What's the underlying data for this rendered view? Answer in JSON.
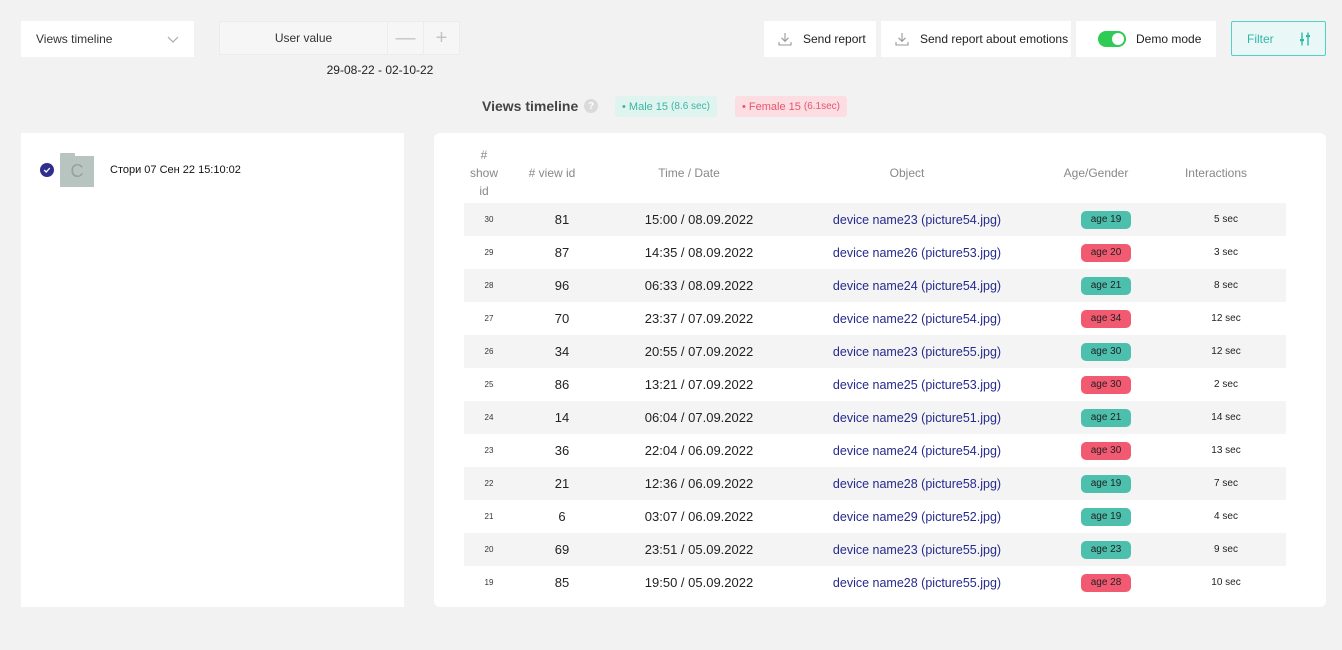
{
  "toolbar": {
    "view_select": "Views timeline",
    "stepper_value": "User value",
    "stepper_minus": "—",
    "stepper_plus": "+",
    "date_range": "29-08-22 - 02-10-22",
    "send_report": "Send report",
    "send_report_emotions": "Send report about emotions",
    "demo_mode": "Demo mode",
    "demo_mode_on": true,
    "filter": "Filter"
  },
  "summary": {
    "title": "Views timeline",
    "help": "?",
    "male_label": "• Male 15",
    "male_sec": "(8.6 sec)",
    "female_label": "• Female 15",
    "female_sec": "(6.1sec)"
  },
  "colors": {
    "male": "#4cbfad",
    "female": "#f25a72",
    "accent": "#2fb8a9",
    "link": "#262a8c"
  },
  "story": {
    "folder_letter": "C",
    "label": "Стори 07 Сен 22 15:10:02"
  },
  "table": {
    "headers": [
      "# show id",
      "# view id",
      "Time / Date",
      "Object",
      "Age/Gender",
      "Interactions"
    ],
    "rows": [
      {
        "show_id": "30",
        "view_id": "81",
        "time": "15:00 / 08.09.2022",
        "object": "device name23 (picture54.jpg)",
        "age": "age 19",
        "gender": "m",
        "interactions": "5 sec"
      },
      {
        "show_id": "29",
        "view_id": "87",
        "time": "14:35 / 08.09.2022",
        "object": "device name26 (picture53.jpg)",
        "age": "age 20",
        "gender": "f",
        "interactions": "3 sec"
      },
      {
        "show_id": "28",
        "view_id": "96",
        "time": "06:33 / 08.09.2022",
        "object": "device name24 (picture54.jpg)",
        "age": "age 21",
        "gender": "m",
        "interactions": "8 sec"
      },
      {
        "show_id": "27",
        "view_id": "70",
        "time": "23:37 / 07.09.2022",
        "object": "device name22 (picture54.jpg)",
        "age": "age 34",
        "gender": "f",
        "interactions": "12 sec"
      },
      {
        "show_id": "26",
        "view_id": "34",
        "time": "20:55 / 07.09.2022",
        "object": "device name23 (picture55.jpg)",
        "age": "age 30",
        "gender": "m",
        "interactions": "12 sec"
      },
      {
        "show_id": "25",
        "view_id": "86",
        "time": "13:21 / 07.09.2022",
        "object": "device name25 (picture53.jpg)",
        "age": "age 30",
        "gender": "f",
        "interactions": "2 sec"
      },
      {
        "show_id": "24",
        "view_id": "14",
        "time": "06:04 / 07.09.2022",
        "object": "device name29 (picture51.jpg)",
        "age": "age 21",
        "gender": "m",
        "interactions": "14 sec"
      },
      {
        "show_id": "23",
        "view_id": "36",
        "time": "22:04 / 06.09.2022",
        "object": "device name24 (picture54.jpg)",
        "age": "age 30",
        "gender": "f",
        "interactions": "13 sec"
      },
      {
        "show_id": "22",
        "view_id": "21",
        "time": "12:36 / 06.09.2022",
        "object": "device name28 (picture58.jpg)",
        "age": "age 19",
        "gender": "m",
        "interactions": "7 sec"
      },
      {
        "show_id": "21",
        "view_id": "6",
        "time": "03:07 / 06.09.2022",
        "object": "device name29 (picture52.jpg)",
        "age": "age 19",
        "gender": "m",
        "interactions": "4 sec"
      },
      {
        "show_id": "20",
        "view_id": "69",
        "time": "23:51 / 05.09.2022",
        "object": "device name23 (picture55.jpg)",
        "age": "age 23",
        "gender": "m",
        "interactions": "9 sec"
      },
      {
        "show_id": "19",
        "view_id": "85",
        "time": "19:50 / 05.09.2022",
        "object": "device name28 (picture55.jpg)",
        "age": "age 28",
        "gender": "f",
        "interactions": "10 sec"
      }
    ]
  }
}
